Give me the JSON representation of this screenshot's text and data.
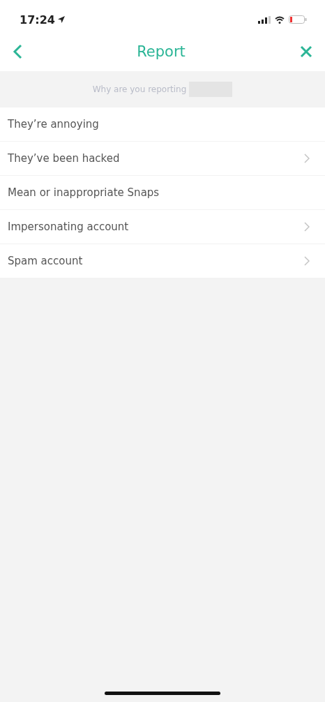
{
  "status_bar": {
    "time": "17:24"
  },
  "nav": {
    "title": "Report"
  },
  "prompt": {
    "text": "Why are you reporting"
  },
  "reasons": [
    {
      "label": "They’re annoying",
      "has_chevron": false
    },
    {
      "label": "They’ve been hacked",
      "has_chevron": true
    },
    {
      "label": "Mean or inappropriate Snaps",
      "has_chevron": false
    },
    {
      "label": "Impersonating account",
      "has_chevron": true
    },
    {
      "label": "Spam account",
      "has_chevron": true
    }
  ]
}
